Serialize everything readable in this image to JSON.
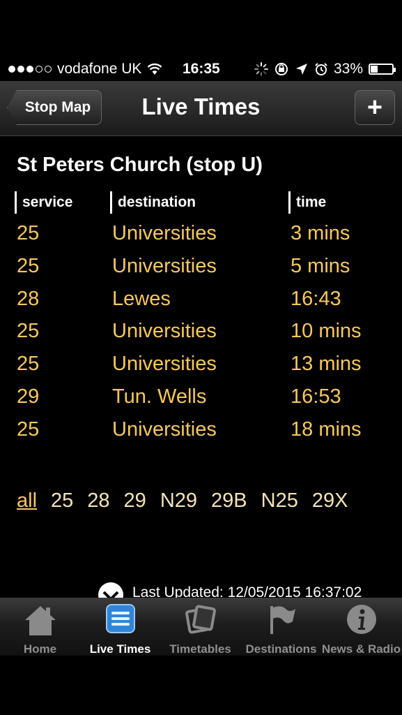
{
  "status_bar": {
    "carrier": "vodafone UK",
    "time": "16:35",
    "battery": "33%",
    "battery_level": 0.33,
    "signal_bars": 3,
    "signal_max": 5
  },
  "nav": {
    "back_label": "Stop Map",
    "title": "Live Times",
    "add_label": "+"
  },
  "stop": {
    "title": "St Peters Church (stop U)"
  },
  "columns": {
    "service": "service",
    "destination": "destination",
    "time": "time"
  },
  "departures": [
    {
      "service": "25",
      "destination": "Universities",
      "time": "3 mins"
    },
    {
      "service": "25",
      "destination": "Universities",
      "time": "5 mins"
    },
    {
      "service": "28",
      "destination": "Lewes",
      "time": "16:43"
    },
    {
      "service": "25",
      "destination": "Universities",
      "time": "10 mins"
    },
    {
      "service": "25",
      "destination": "Universities",
      "time": "13 mins"
    },
    {
      "service": "29",
      "destination": "Tun. Wells",
      "time": "16:53"
    },
    {
      "service": "25",
      "destination": "Universities",
      "time": "18 mins"
    }
  ],
  "filters": [
    "all",
    "25",
    "28",
    "29",
    "N29",
    "29B",
    "N25",
    "29X"
  ],
  "active_filter": "all",
  "last_updated": "Last Updated: 12/05/2015 16:37:02",
  "tabs": [
    {
      "label": "Home",
      "icon": "home-icon"
    },
    {
      "label": "Live Times",
      "icon": "live-times-icon"
    },
    {
      "label": "Timetables",
      "icon": "timetables-icon"
    },
    {
      "label": "Destinations",
      "icon": "destinations-flag-icon"
    },
    {
      "label": "News & Radio",
      "icon": "info-icon"
    }
  ],
  "active_tab": "Live Times",
  "colors": {
    "accent": "#f6c85f",
    "active_tab_icon": "#2f86d9"
  }
}
